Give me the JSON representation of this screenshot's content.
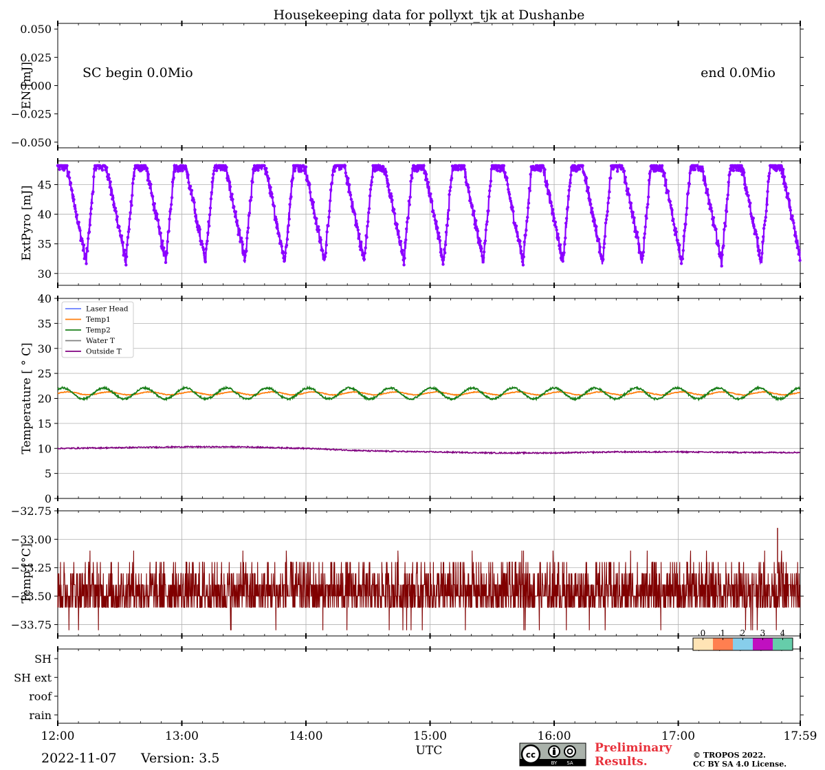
{
  "title": "Housekeeping data for pollyxt_tjk at Dushanbe",
  "footer": {
    "date": "2022-11-07",
    "version": "Version: 3.5",
    "preliminary_line1": "Preliminary",
    "preliminary_line2": "Results.",
    "copyright_line1": "© TROPOS 2022.",
    "copyright_line2": "CC BY SA 4.0 License.",
    "license_badge": {
      "by": "BY",
      "sa": "SA",
      "cc": "cc"
    }
  },
  "colors": {
    "extpyro": "#8b00ff",
    "laser_head": "#6a7fff",
    "temp1": "#ff7f0e",
    "temp2": "#1a7f1a",
    "water_t": "#808080",
    "outside_t": "#800080",
    "laser_temp": "#800000",
    "grid": "#b0b0b0",
    "preliminary": "#e8323c",
    "status_colors": [
      "#ffe4b5",
      "#ff7f50",
      "#87ceeb",
      "#c010c0",
      "#66cdaa"
    ]
  },
  "chart_data": [
    {
      "type": "line",
      "panel": "energy",
      "ylabel": "EN [mJ]",
      "ylim": [
        -0.055,
        0.055
      ],
      "yticks": [
        0.05,
        0.025,
        0.0,
        -0.025,
        -0.05
      ],
      "ytick_labels": [
        "0.050",
        "0.025",
        "0.000",
        "−0.025",
        "−0.050"
      ],
      "annotation_left": "SC begin 0.0Mio",
      "annotation_right": "end 0.0Mio",
      "grid": false,
      "series": []
    },
    {
      "type": "line",
      "panel": "extpyro",
      "ylabel": "ExtPyro [mJ]",
      "ylim": [
        28,
        49
      ],
      "yticks": [
        30,
        35,
        40,
        45
      ],
      "ytick_labels": [
        "30",
        "35",
        "40",
        "45"
      ],
      "grid": true,
      "series": [
        {
          "period_hours": 0.32,
          "min": 32,
          "max": 48.2,
          "plateau_fraction": 0.28
        }
      ]
    },
    {
      "type": "line",
      "panel": "temperature",
      "ylabel": "Temperature [$^\\circ C$]",
      "ylabel_display": "Temperature [ ° C]",
      "ylim": [
        0,
        40
      ],
      "yticks": [
        0,
        5,
        10,
        15,
        20,
        25,
        30,
        35,
        40
      ],
      "ytick_labels": [
        "0",
        "5",
        "10",
        "15",
        "20",
        "25",
        "30",
        "35",
        "40"
      ],
      "grid": true,
      "legend_placement": "top-left",
      "series": [
        {
          "name": "Laser Head",
          "values": []
        },
        {
          "name": "Temp1",
          "mean": 21.0,
          "amplitude": 0.3
        },
        {
          "name": "Temp2",
          "mean": 21.0,
          "amplitude": 1.1,
          "period_hours": 0.33
        },
        {
          "name": "Water T",
          "values": []
        },
        {
          "name": "Outside T",
          "x_hours": [
            12.0,
            13.0,
            13.5,
            14.0,
            14.5,
            15.0,
            15.5,
            16.0,
            16.5,
            17.0,
            17.5,
            17.98
          ],
          "values": [
            10.0,
            10.3,
            10.3,
            10.0,
            9.5,
            9.3,
            9.1,
            9.1,
            9.3,
            9.3,
            9.2,
            9.2
          ]
        }
      ]
    },
    {
      "type": "line",
      "panel": "laser_temp",
      "ylabel": "Temp [°C]",
      "ylim": [
        -33.85,
        -32.75
      ],
      "yticks": [
        -32.75,
        -33.0,
        -33.25,
        -33.5,
        -33.75
      ],
      "ytick_labels": [
        "−32.75",
        "−33.00",
        "−33.25",
        "−33.50",
        "−33.75"
      ],
      "grid": true,
      "series": [
        {
          "levels": [
            -33.2,
            -33.3,
            -33.4,
            -33.5,
            -33.6
          ],
          "outliers_low": -33.8,
          "outliers_high": -32.9
        }
      ]
    },
    {
      "type": "heatmap",
      "panel": "status",
      "categories": [
        "SH",
        "SH ext",
        "roof",
        "rain"
      ],
      "colorbar_ticks": [
        "0",
        "1",
        "2",
        "3",
        "4"
      ],
      "grid": false
    }
  ],
  "x_axis": {
    "xlabel": "UTC",
    "range_hours": [
      12.0,
      17.983
    ],
    "tick_hours": [
      12,
      13,
      14,
      15,
      16,
      17,
      17.983
    ],
    "tick_labels": [
      "12:00",
      "13:00",
      "14:00",
      "15:00",
      "16:00",
      "17:00",
      "17:59"
    ]
  }
}
